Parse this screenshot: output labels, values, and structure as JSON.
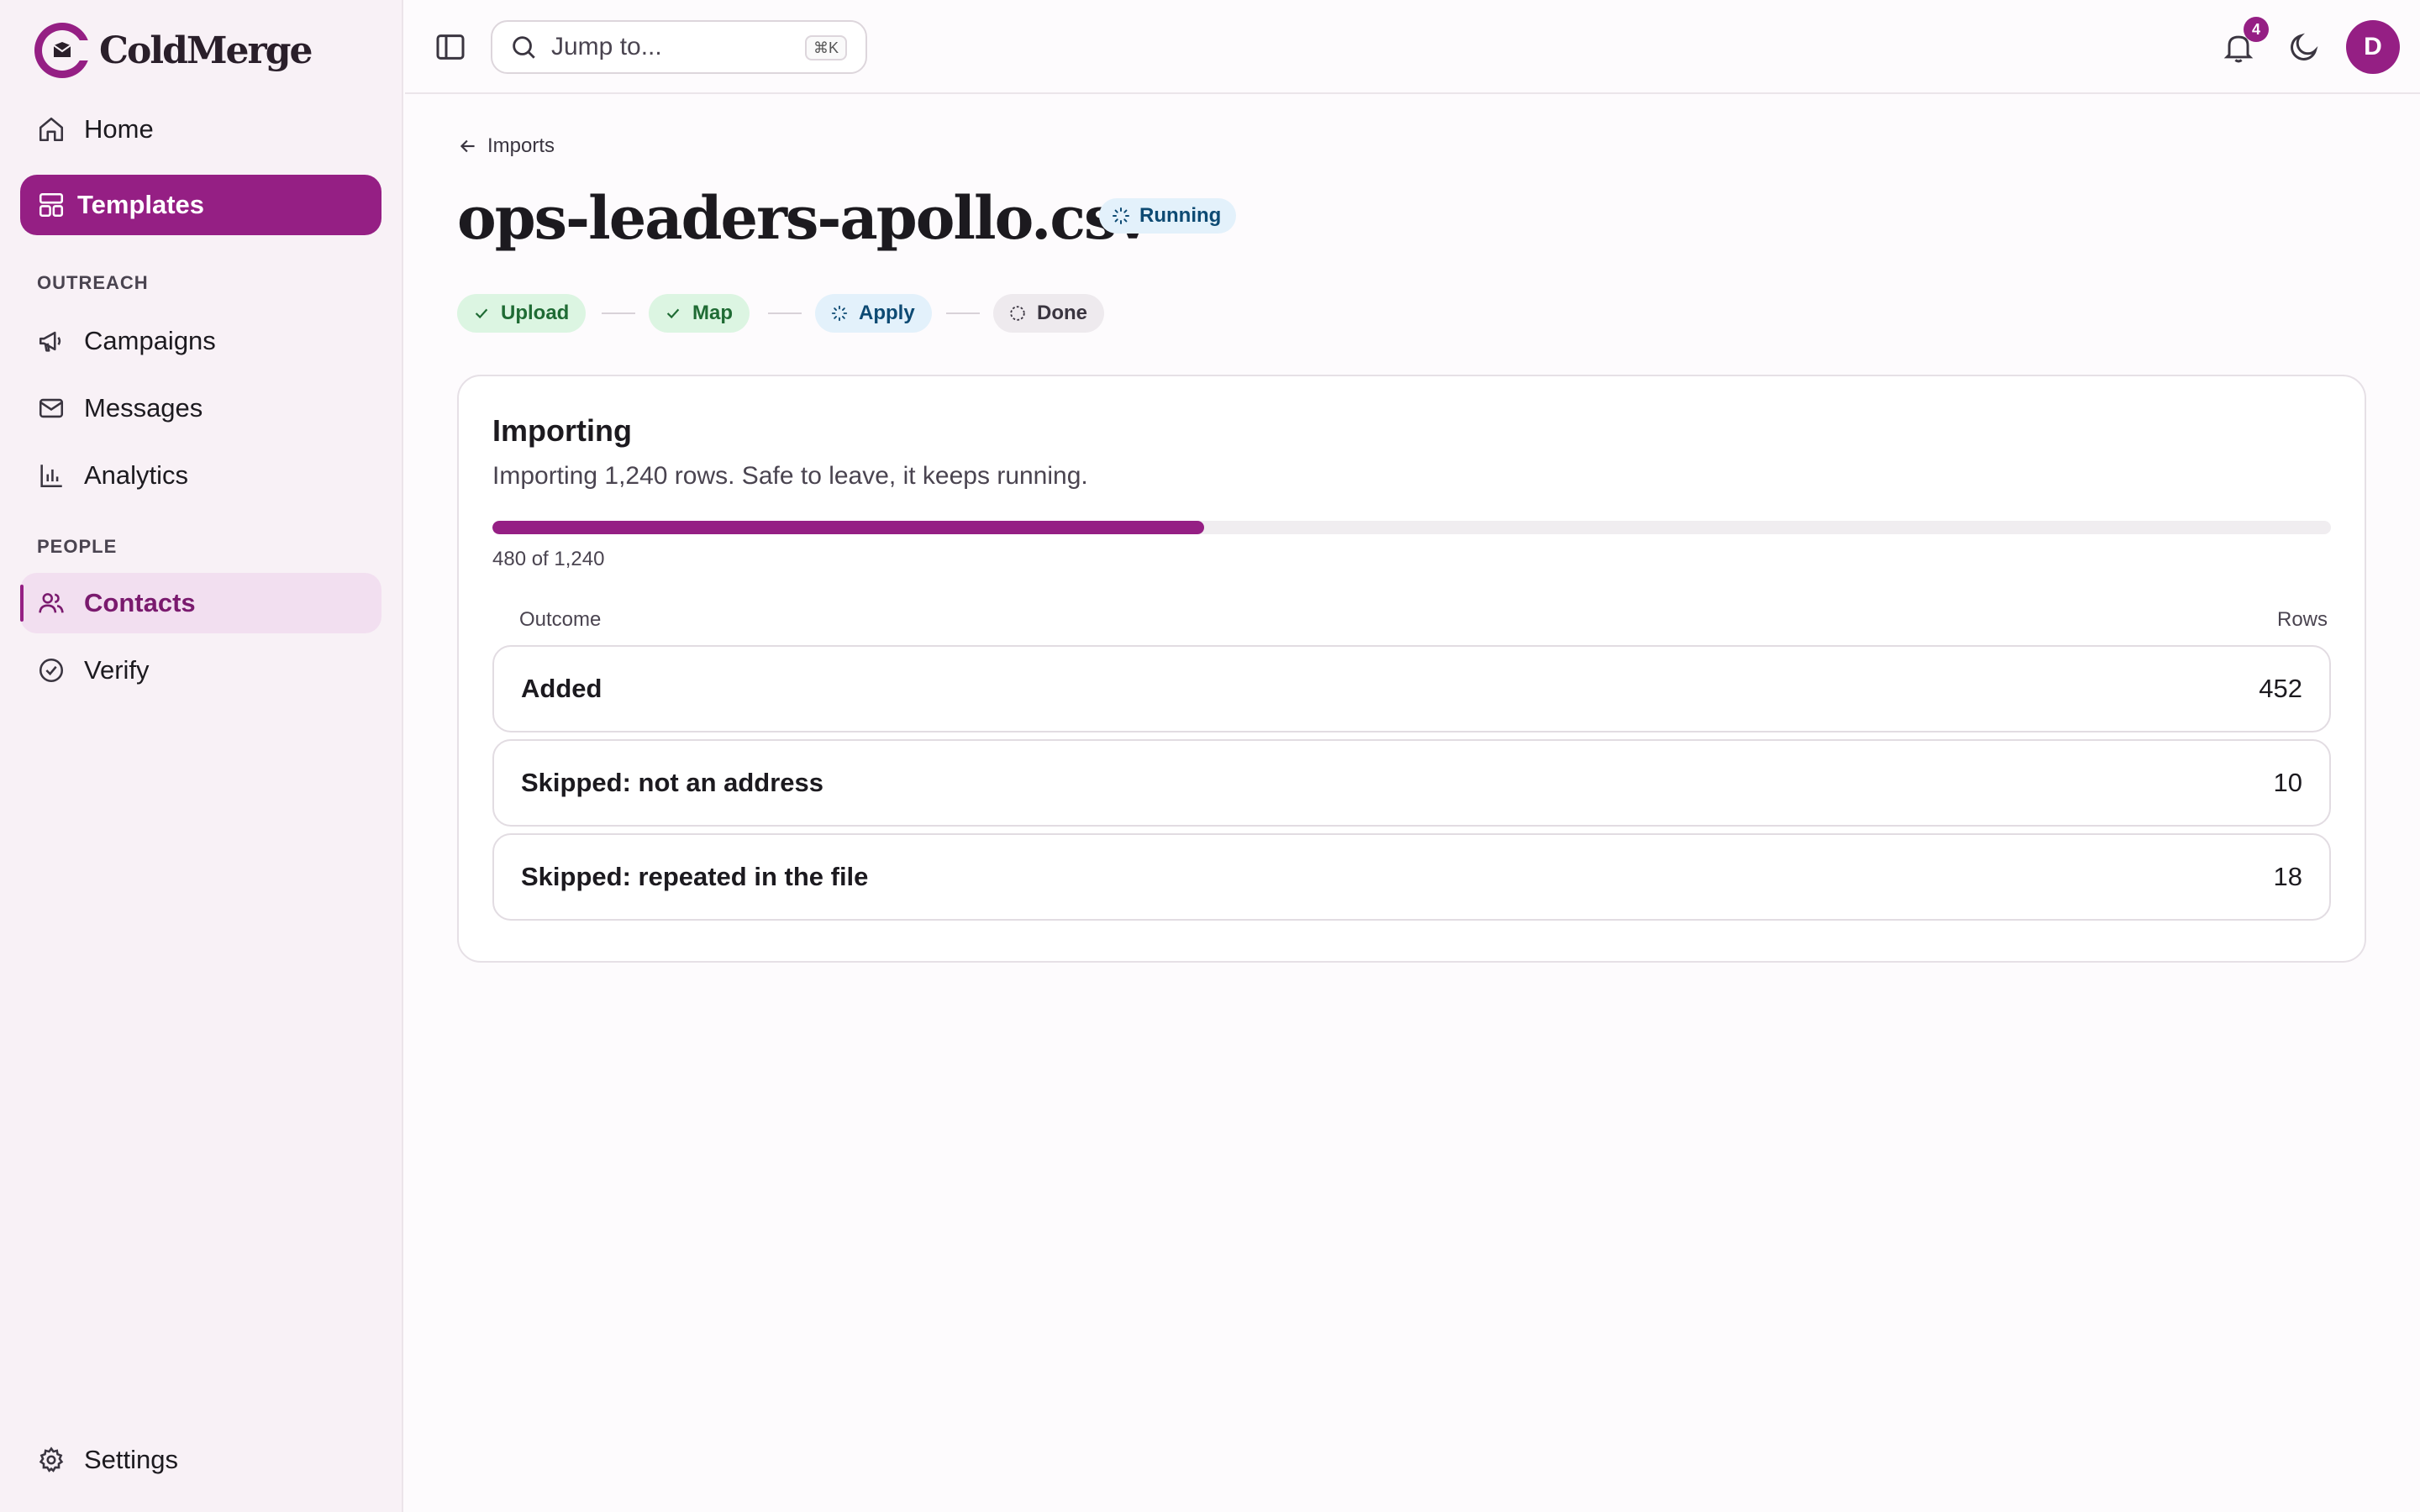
{
  "brand": {
    "name": "ColdMerge"
  },
  "sidebar": {
    "top_items": [
      {
        "label": "Home",
        "icon": "home-icon"
      },
      {
        "label": "Templates",
        "icon": "template-icon"
      }
    ],
    "sections": [
      {
        "label": "OUTREACH",
        "items": [
          {
            "label": "Campaigns",
            "icon": "megaphone-icon"
          },
          {
            "label": "Messages",
            "icon": "mail-icon"
          },
          {
            "label": "Analytics",
            "icon": "chart-icon"
          }
        ]
      },
      {
        "label": "PEOPLE",
        "items": [
          {
            "label": "Contacts",
            "icon": "users-icon"
          },
          {
            "label": "Verify",
            "icon": "check-circle-icon"
          }
        ]
      }
    ],
    "settings": {
      "label": "Settings",
      "icon": "gear-icon"
    }
  },
  "topbar": {
    "search_placeholder": "Jump to...",
    "search_shortcut": "⌘K",
    "notification_count": "4",
    "avatar_initial": "D"
  },
  "page": {
    "back_label": "Imports",
    "title": "ops-leaders-apollo.csv",
    "status": "Running",
    "steps": [
      {
        "label": "Upload",
        "state": "done"
      },
      {
        "label": "Map",
        "state": "done"
      },
      {
        "label": "Apply",
        "state": "active"
      },
      {
        "label": "Done",
        "state": "pending"
      }
    ],
    "card": {
      "title": "Importing",
      "description": "Importing 1,240 rows. Safe to leave, it keeps running.",
      "progress_done": 480,
      "progress_total": 1240,
      "progress_label": "480 of 1,240",
      "columns": {
        "outcome": "Outcome",
        "rows": "Rows"
      },
      "results": [
        {
          "outcome": "Added",
          "rows": "452"
        },
        {
          "outcome": "Skipped: not an address",
          "rows": "10"
        },
        {
          "outcome": "Skipped: repeated in the file",
          "rows": "18"
        }
      ]
    }
  },
  "colors": {
    "accent": "#951f84",
    "running_bg": "#e3f1fb",
    "done_bg": "#dcf5e2"
  }
}
